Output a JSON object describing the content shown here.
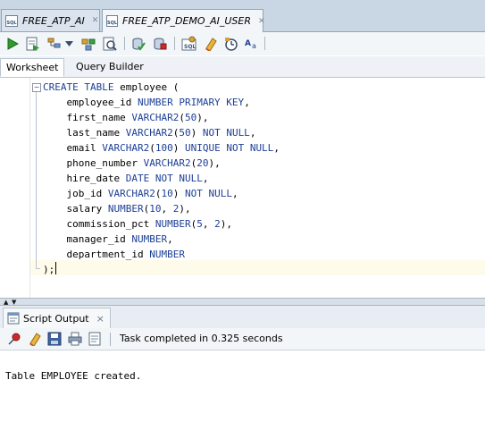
{
  "connection_tabs": [
    {
      "label": "FREE_ATP_AI",
      "active": false
    },
    {
      "label": "FREE_ATP_DEMO_AI_USER",
      "active": true
    }
  ],
  "toolbar": {
    "icons": [
      "run-statement-icon",
      "run-script-icon",
      "explain-plan-icon",
      "autotrace-icon",
      "sql-tuning-icon",
      "commit-icon",
      "rollback-icon",
      "unshared-sql-icon",
      "clear-icon",
      "history-icon",
      "format-icon"
    ]
  },
  "worksheet_tabs": [
    {
      "label": "Worksheet",
      "active": true
    },
    {
      "label": "Query Builder",
      "active": false
    }
  ],
  "editor": {
    "lines": [
      [
        {
          "t": "CREATE TABLE",
          "c": "kw"
        },
        {
          "t": " employee (",
          "c": ""
        }
      ],
      [
        {
          "t": "    employee_id ",
          "c": ""
        },
        {
          "t": "NUMBER PRIMARY KEY",
          "c": "kw"
        },
        {
          "t": ",",
          "c": ""
        }
      ],
      [
        {
          "t": "    first_name ",
          "c": ""
        },
        {
          "t": "VARCHAR2",
          "c": "kw"
        },
        {
          "t": "(",
          "c": ""
        },
        {
          "t": "50",
          "c": "num"
        },
        {
          "t": "),",
          "c": ""
        }
      ],
      [
        {
          "t": "    last_name ",
          "c": ""
        },
        {
          "t": "VARCHAR2",
          "c": "kw"
        },
        {
          "t": "(",
          "c": ""
        },
        {
          "t": "50",
          "c": "num"
        },
        {
          "t": ") ",
          "c": ""
        },
        {
          "t": "NOT NULL",
          "c": "kw"
        },
        {
          "t": ",",
          "c": ""
        }
      ],
      [
        {
          "t": "    email ",
          "c": ""
        },
        {
          "t": "VARCHAR2",
          "c": "kw"
        },
        {
          "t": "(",
          "c": ""
        },
        {
          "t": "100",
          "c": "num"
        },
        {
          "t": ") ",
          "c": ""
        },
        {
          "t": "UNIQUE NOT NULL",
          "c": "kw"
        },
        {
          "t": ",",
          "c": ""
        }
      ],
      [
        {
          "t": "    phone_number ",
          "c": ""
        },
        {
          "t": "VARCHAR2",
          "c": "kw"
        },
        {
          "t": "(",
          "c": ""
        },
        {
          "t": "20",
          "c": "num"
        },
        {
          "t": "),",
          "c": ""
        }
      ],
      [
        {
          "t": "    hire_date ",
          "c": ""
        },
        {
          "t": "DATE NOT NULL",
          "c": "kw"
        },
        {
          "t": ",",
          "c": ""
        }
      ],
      [
        {
          "t": "    job_id ",
          "c": ""
        },
        {
          "t": "VARCHAR2",
          "c": "kw"
        },
        {
          "t": "(",
          "c": ""
        },
        {
          "t": "10",
          "c": "num"
        },
        {
          "t": ") ",
          "c": ""
        },
        {
          "t": "NOT NULL",
          "c": "kw"
        },
        {
          "t": ",",
          "c": ""
        }
      ],
      [
        {
          "t": "    salary ",
          "c": ""
        },
        {
          "t": "NUMBER",
          "c": "kw"
        },
        {
          "t": "(",
          "c": ""
        },
        {
          "t": "10",
          "c": "num"
        },
        {
          "t": ", ",
          "c": ""
        },
        {
          "t": "2",
          "c": "num"
        },
        {
          "t": "),",
          "c": ""
        }
      ],
      [
        {
          "t": "    commission_pct ",
          "c": ""
        },
        {
          "t": "NUMBER",
          "c": "kw"
        },
        {
          "t": "(",
          "c": ""
        },
        {
          "t": "5",
          "c": "num"
        },
        {
          "t": ", ",
          "c": ""
        },
        {
          "t": "2",
          "c": "num"
        },
        {
          "t": "),",
          "c": ""
        }
      ],
      [
        {
          "t": "    manager_id ",
          "c": ""
        },
        {
          "t": "NUMBER",
          "c": "kw"
        },
        {
          "t": ",",
          "c": ""
        }
      ],
      [
        {
          "t": "    department_id ",
          "c": ""
        },
        {
          "t": "NUMBER",
          "c": "kw"
        }
      ],
      [
        {
          "t": ");",
          "c": ""
        }
      ]
    ]
  },
  "output": {
    "tab_label": "Script Output",
    "close_glyph": "×",
    "status": "Task completed in 0.325 seconds",
    "text": "Table EMPLOYEE created."
  },
  "colors": {
    "keyword": "#1c3f95",
    "current_line": "#fffbea",
    "tab_strip": "#c9d6e4"
  }
}
